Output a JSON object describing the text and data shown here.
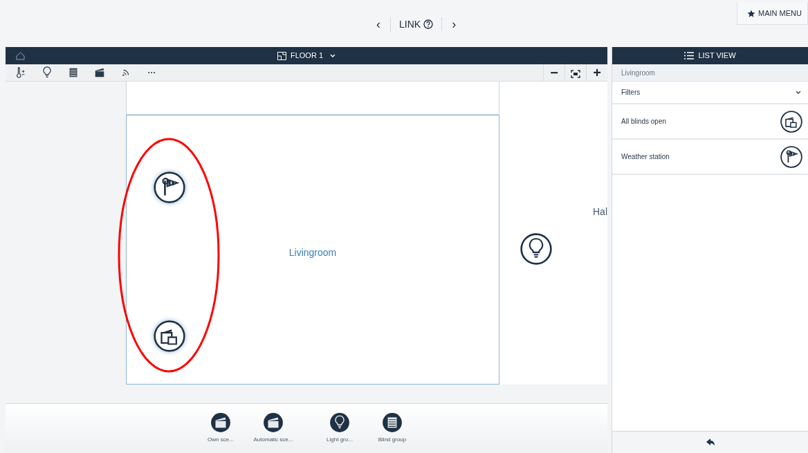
{
  "top_bar": {
    "prev": "‹",
    "title": "LINK",
    "next": "›",
    "main_menu": "MAIN MENU"
  },
  "floor_header": {
    "title": "FLOOR 1"
  },
  "toolbar": {
    "tools": [
      {
        "kind": "temperature"
      },
      {
        "kind": "light"
      },
      {
        "kind": "blind"
      },
      {
        "kind": "scene"
      },
      {
        "kind": "signal"
      }
    ],
    "more": "···",
    "zoom_out": "−",
    "zoom_in": "+"
  },
  "floorplan": {
    "rooms": [
      {
        "name": "Livingroom",
        "devices": [
          {
            "kind": "weather"
          },
          {
            "kind": "blind-scene"
          }
        ]
      },
      {
        "name": "Hal",
        "devices": [
          {
            "kind": "light"
          }
        ]
      }
    ],
    "annotation": {
      "color": "#ff0000"
    }
  },
  "list_view": {
    "title": "LIST VIEW",
    "breadcrumb": "Livingroom",
    "filters": "Filters",
    "items": [
      {
        "label": "All blinds open",
        "kind": "blind-scene"
      },
      {
        "label": "Weather station",
        "kind": "weather"
      }
    ]
  },
  "bottom_bar": {
    "groups": [
      {
        "label": "Own sce...",
        "kind": "scene"
      },
      {
        "label": "Automatic sce...",
        "kind": "scene"
      },
      {
        "label": "Light gro...",
        "kind": "light"
      },
      {
        "label": "Blind group",
        "kind": "blind"
      }
    ]
  }
}
